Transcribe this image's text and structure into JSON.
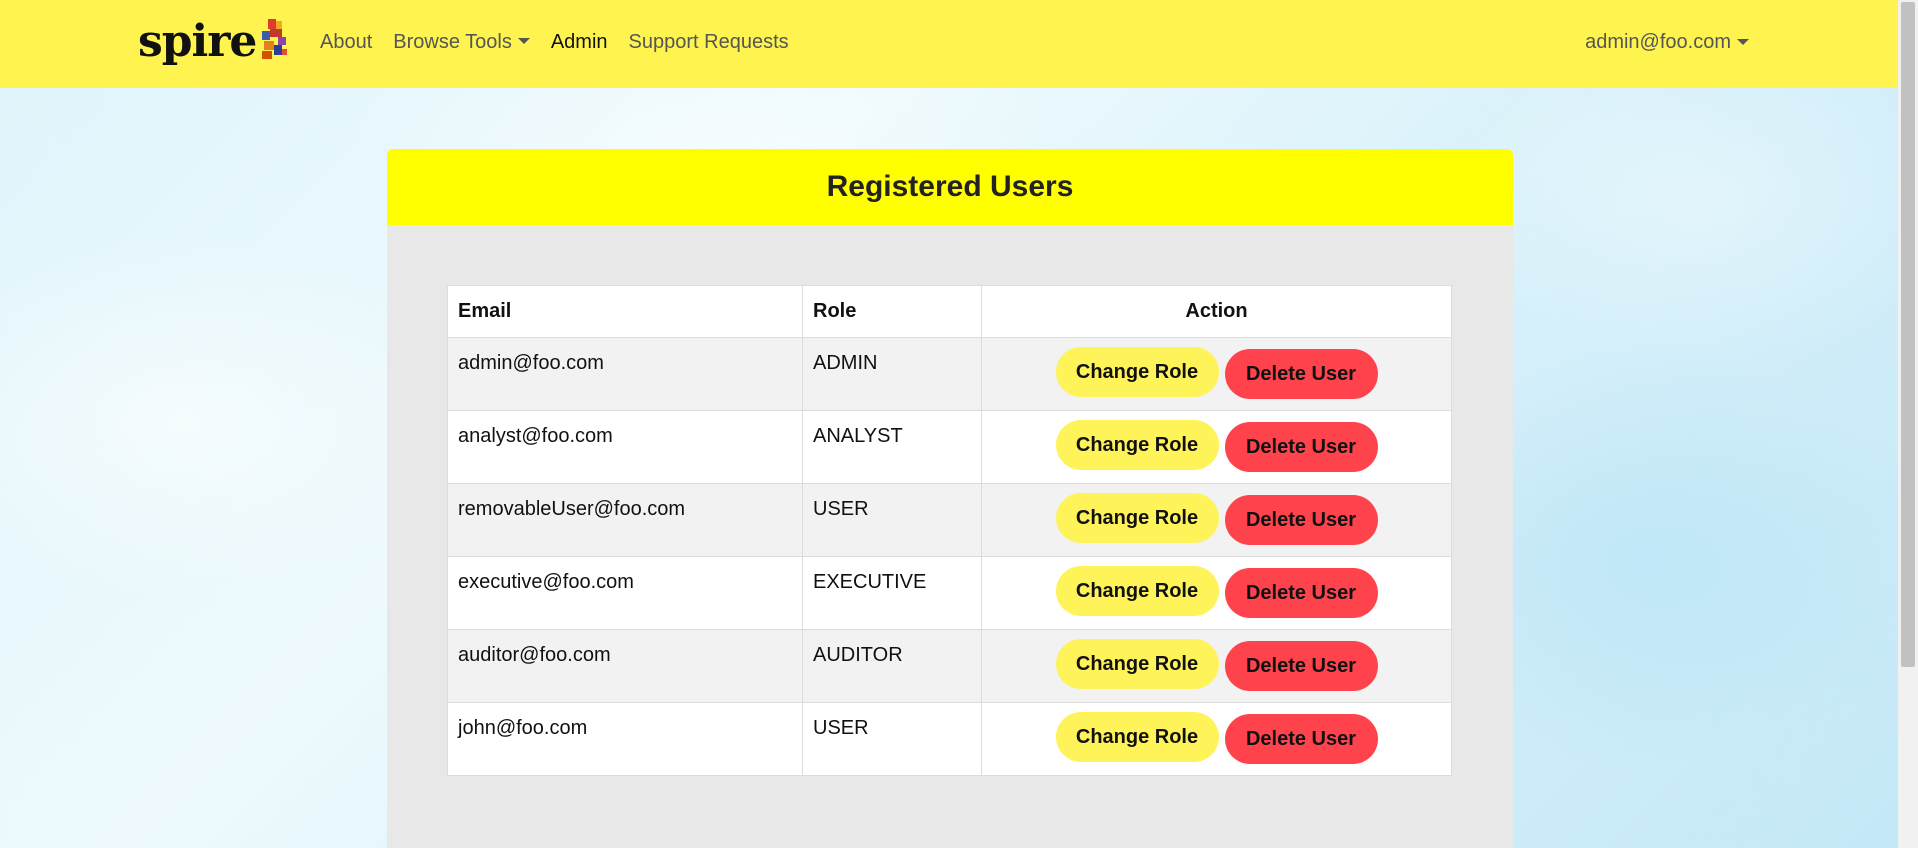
{
  "navbar": {
    "brand": "spire",
    "links": [
      {
        "label": "About",
        "dropdown": false,
        "active": false
      },
      {
        "label": "Browse Tools",
        "dropdown": true,
        "active": false
      },
      {
        "label": "Admin",
        "dropdown": false,
        "active": true
      },
      {
        "label": "Support Requests",
        "dropdown": false,
        "active": false
      }
    ],
    "user_menu": "admin@foo.com"
  },
  "card": {
    "title": "Registered Users"
  },
  "table": {
    "headers": {
      "email": "Email",
      "role": "Role",
      "action": "Action"
    },
    "rows": [
      {
        "email": "admin@foo.com",
        "role": "ADMIN"
      },
      {
        "email": "analyst@foo.com",
        "role": "ANALYST"
      },
      {
        "email": "removableUser@foo.com",
        "role": "USER"
      },
      {
        "email": "executive@foo.com",
        "role": "EXECUTIVE"
      },
      {
        "email": "auditor@foo.com",
        "role": "AUDITOR"
      },
      {
        "email": "john@foo.com",
        "role": "USER"
      }
    ],
    "change_role_label": "Change Role",
    "delete_user_label": "Delete User"
  },
  "colors": {
    "navbar": "#fff44f",
    "card_header": "#ffff00",
    "change_role_button": "#fff35a",
    "delete_user_button": "#ff434d"
  }
}
